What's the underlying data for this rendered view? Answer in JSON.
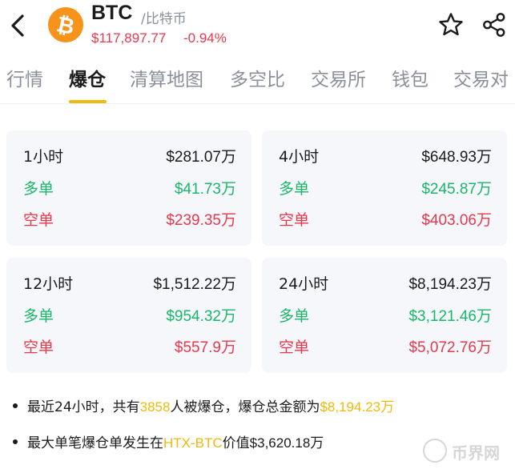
{
  "header": {
    "symbol": "BTC",
    "name": "/比特币",
    "price": "$117,897.77",
    "change": "-0.94%",
    "logo_glyph": "₿",
    "icons": [
      "back-arrow-icon",
      "btc-logo-icon",
      "star-icon",
      "share-icon"
    ],
    "colors": {
      "logo": "#f7931a",
      "down": "#e6394d",
      "up": "#1ab76a",
      "accent": "#f0b90b"
    }
  },
  "tabs": [
    {
      "label": "行情",
      "active": false
    },
    {
      "label": "爆仓",
      "active": true
    },
    {
      "label": "清算地图",
      "active": false
    },
    {
      "label": "多空比",
      "active": false
    },
    {
      "label": "交易所",
      "active": false
    },
    {
      "label": "钱包",
      "active": false
    },
    {
      "label": "交易对",
      "active": false
    }
  ],
  "cards": [
    {
      "period": "1小时",
      "total": "$281.07万",
      "long_label": "多单",
      "long": "$41.73万",
      "short_label": "空单",
      "short": "$239.35万"
    },
    {
      "period": "4小时",
      "total": "$648.93万",
      "long_label": "多单",
      "long": "$245.87万",
      "short_label": "空单",
      "short": "$403.06万"
    },
    {
      "period": "12小时",
      "total": "$1,512.22万",
      "long_label": "多单",
      "long": "$954.32万",
      "short_label": "空单",
      "short": "$557.9万"
    },
    {
      "period": "24小时",
      "total": "$8,194.23万",
      "long_label": "多单",
      "long": "$3,121.46万",
      "short_label": "空单",
      "short": "$5,072.76万"
    }
  ],
  "summary": {
    "line1_prefix": "最近24小时，共有",
    "line1_count": "3858",
    "line1_mid": "人被爆仓，爆仓总金额为",
    "line1_amount": "$8,194.23万",
    "line2_prefix": "最大单笔爆仓单发生在",
    "line2_exchange": "HTX-BTC",
    "line2_mid": "价值",
    "line2_amount": "$3,620.18万"
  },
  "watermark": {
    "text": "币界网"
  }
}
